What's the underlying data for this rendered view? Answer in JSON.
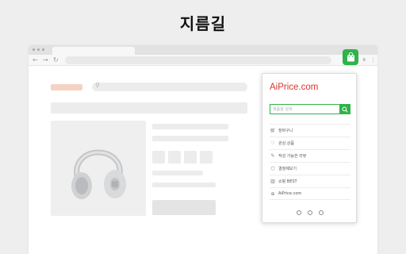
{
  "headline": "지름길",
  "browser": {
    "nav": {
      "back": "←",
      "forward": "→",
      "reload": "↻"
    },
    "toolbar_icons": {
      "extra": "⋮"
    }
  },
  "popup": {
    "brand_prefix": "Ai",
    "brand_main": "Price.com",
    "search_placeholder": "제품을 검색",
    "menu": [
      {
        "icon": "cart-icon",
        "label": "장바구니"
      },
      {
        "icon": "heart-icon",
        "label": "관심 상품"
      },
      {
        "icon": "comment-icon",
        "label": "작성 가능한 리뷰"
      },
      {
        "icon": "box-icon",
        "label": "결정제보기"
      },
      {
        "icon": "trophy-icon",
        "label": "쇼핑 BEST"
      },
      {
        "icon": "link-icon",
        "label": "AiPrice.com"
      }
    ]
  },
  "colors": {
    "accent": "#2fb34a",
    "brand": "#e0342c"
  }
}
